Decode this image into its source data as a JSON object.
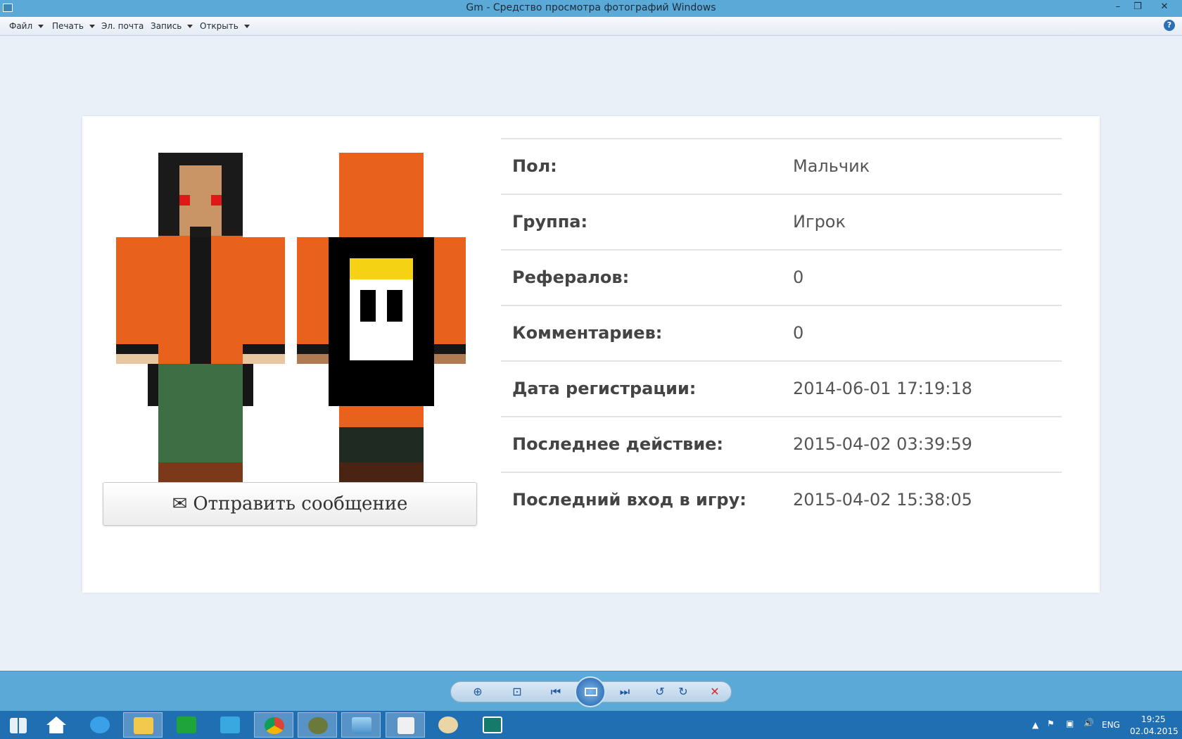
{
  "window": {
    "title": "Gm - Средство просмотра фотографий Windows",
    "controls": [
      "–",
      "❐",
      "✕"
    ]
  },
  "menu": {
    "items": [
      {
        "label": "Файл",
        "has_dropdown": true
      },
      {
        "label": "Печать",
        "has_dropdown": true
      },
      {
        "label": "Эл. почта",
        "has_dropdown": false
      },
      {
        "label": "Запись",
        "has_dropdown": true
      },
      {
        "label": "Открыть",
        "has_dropdown": true
      }
    ],
    "help_icon": "help-icon"
  },
  "profile": {
    "send_button_label": "Отправить сообщение",
    "send_button_icon": "envelope-icon",
    "fields": [
      {
        "label": "Пол:",
        "value": "Мальчик"
      },
      {
        "label": "Группа:",
        "value": "Игрок"
      },
      {
        "label": "Рефералов:",
        "value": "0"
      },
      {
        "label": "Комментариев:",
        "value": "0"
      },
      {
        "label": "Дата регистрации:",
        "value": "2014-06-01 17:19:18"
      },
      {
        "label": "Последнее действие:",
        "value": "2015-04-02 03:39:59"
      },
      {
        "label": "Последний вход в игру:",
        "value": "2015-04-02 15:38:05"
      }
    ],
    "skin_colors": {
      "orange": "#e8621e",
      "black": "#161616",
      "skin": "#c99466",
      "green": "#3e6e43",
      "brown": "#7a3a1a",
      "crown": "#f5d213",
      "eyes": "#e01818"
    }
  },
  "viewer_toolbar": {
    "buttons": [
      "zoom-icon",
      "fit-icon",
      "previous-icon",
      "slideshow-icon",
      "next-icon",
      "rotate-left-icon",
      "rotate-right-icon",
      "delete-icon"
    ]
  },
  "taskbar": {
    "apps": [
      "start-icon",
      "home-icon",
      "internet-explorer-icon",
      "file-explorer-icon",
      "store-icon",
      "mail-icon",
      "chrome-icon",
      "gm-app-icon",
      "photo-viewer-icon",
      "document-icon",
      "paint-icon",
      "image-icon"
    ],
    "tray": {
      "language": "ENG",
      "time": "19:25",
      "date": "02.04.2015"
    }
  }
}
